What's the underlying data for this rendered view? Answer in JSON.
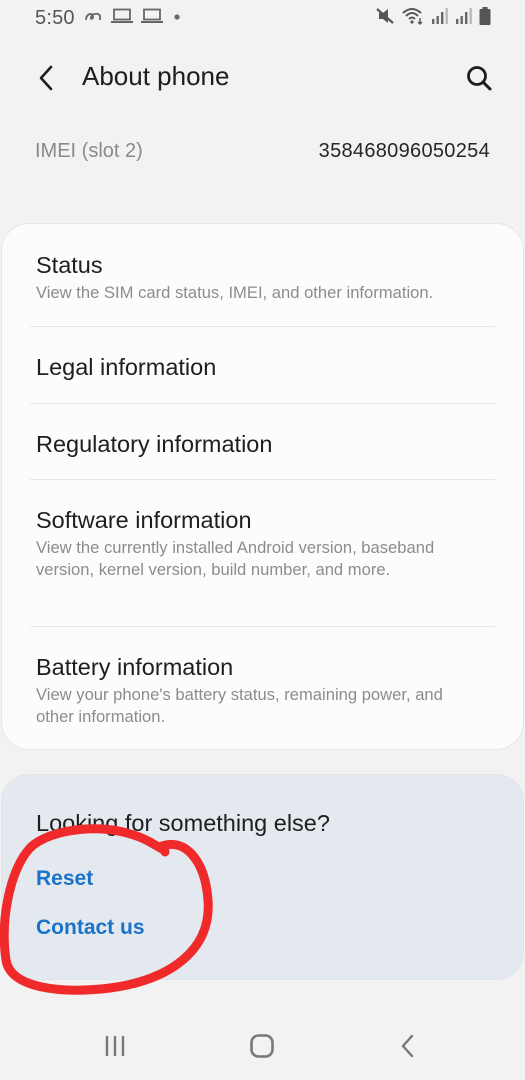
{
  "status_bar": {
    "time": "5:50",
    "left_icons": [
      "notification-swirl-icon",
      "laptop-icon",
      "laptop-icon",
      "dot-icon"
    ],
    "right_icons": [
      "mute-icon",
      "wifi-icon",
      "signal-icon",
      "signal-icon",
      "battery-icon"
    ]
  },
  "header": {
    "back_icon": "back-chevron-icon",
    "title": "About phone",
    "search_icon": "search-icon"
  },
  "imei": {
    "label": "IMEI (slot 2)",
    "value": "358468096050254"
  },
  "menu": {
    "items": [
      {
        "title": "Status",
        "subtitle": "View the SIM card status, IMEI, and other information."
      },
      {
        "title": "Legal information",
        "subtitle": ""
      },
      {
        "title": "Regulatory information",
        "subtitle": ""
      },
      {
        "title": "Software information",
        "subtitle": "View the currently installed Android version, baseband version, kernel version, build number, and more."
      },
      {
        "title": "Battery information",
        "subtitle": "View your phone's battery status, remaining power, and other information."
      }
    ]
  },
  "suggestions": {
    "title": "Looking for something else?",
    "links": [
      {
        "label": "Reset"
      },
      {
        "label": "Contact us"
      }
    ]
  },
  "nav_bar": {
    "recents_icon": "recents-icon",
    "home_icon": "home-icon",
    "back_icon": "back-icon"
  },
  "colors": {
    "background": "#f2f2f2",
    "card": "#fcfcfc",
    "suggestion_box": "#e3e9ef",
    "link": "#1a73c8",
    "annotation": "#f02a2a"
  }
}
